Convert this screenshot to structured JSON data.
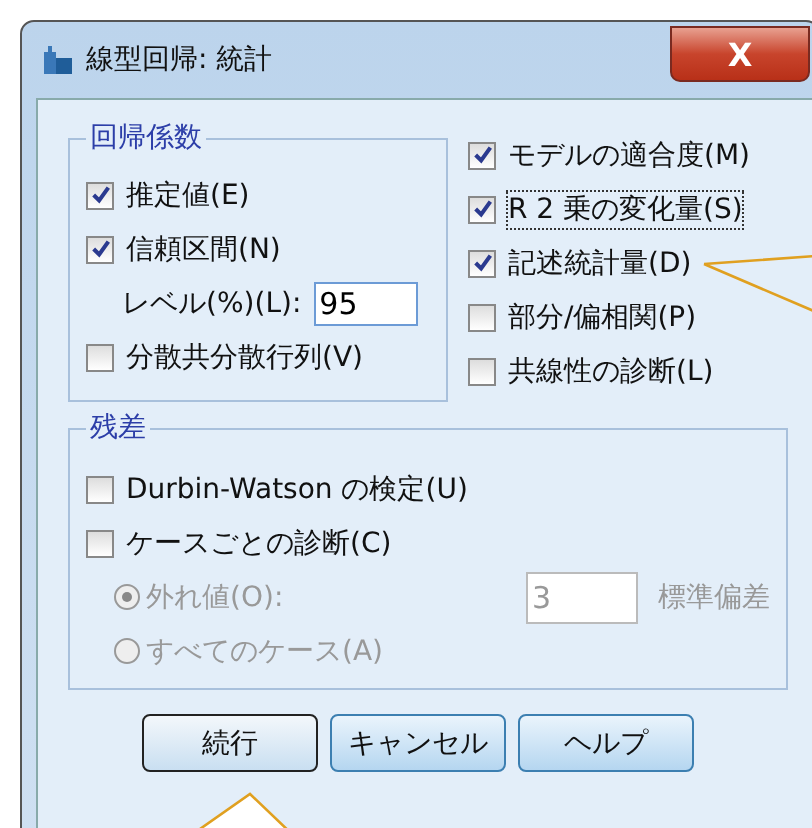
{
  "window": {
    "title": "線型回帰: 統計",
    "close": "X"
  },
  "coefficients": {
    "title": "回帰係数",
    "items": [
      {
        "kind": "checkbox",
        "label": "推定値(E)",
        "checked": true
      },
      {
        "kind": "checkbox",
        "label": "信頼区間(N)",
        "checked": true
      },
      {
        "kind": "input",
        "label": "レベル(%)(L):",
        "value": "95"
      },
      {
        "kind": "checkbox",
        "label": "分散共分散行列(V)",
        "checked": false
      }
    ]
  },
  "options": [
    {
      "label": "モデルの適合度(M)",
      "checked": true,
      "focused": false
    },
    {
      "label": "R 2 乗の変化量(S)",
      "checked": true,
      "focused": true
    },
    {
      "label": "記述統計量(D)",
      "checked": true,
      "focused": false
    },
    {
      "label": "部分/偏相関(P)",
      "checked": false,
      "focused": false
    },
    {
      "label": "共線性の診断(L)",
      "checked": false,
      "focused": false
    }
  ],
  "residuals": {
    "title": "残差",
    "items": [
      {
        "kind": "checkbox",
        "label": "Durbin-Watson の検定(U)",
        "checked": false,
        "disabled": false
      },
      {
        "kind": "checkbox",
        "label": "ケースごとの診断(C)",
        "checked": false,
        "disabled": false
      },
      {
        "kind": "radio",
        "label": "外れ値(O):",
        "selected": true,
        "disabled": true,
        "value": "3",
        "unit": "標準偏差"
      },
      {
        "kind": "radio",
        "label": "すべてのケース(A)",
        "selected": false,
        "disabled": true
      }
    ]
  },
  "buttons": [
    {
      "label": "続行",
      "default": true
    },
    {
      "label": "キャンセル",
      "default": false
    },
    {
      "label": "ヘルプ",
      "default": false
    }
  ]
}
